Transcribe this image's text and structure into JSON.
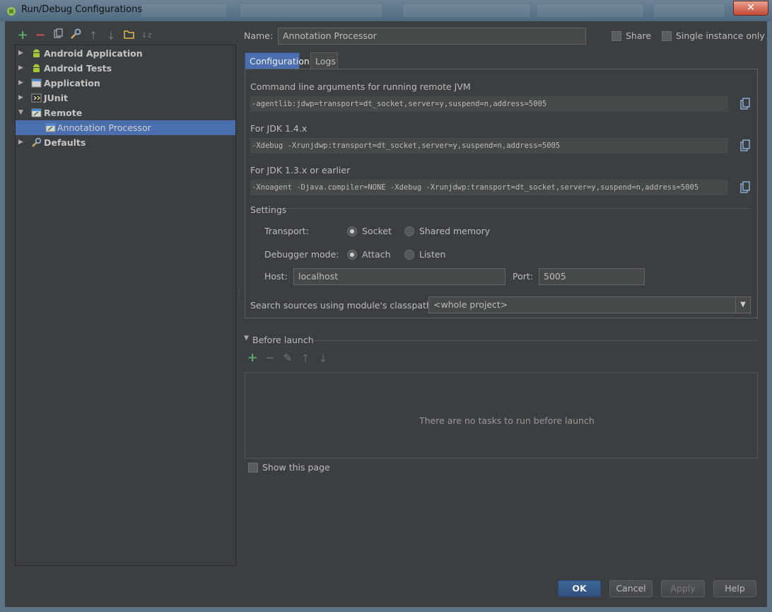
{
  "window": {
    "title": "Run/Debug Configurations",
    "close_glyph": "✕"
  },
  "toolbar_left": {
    "icons": [
      "plus-icon",
      "minus-icon",
      "copy-icon",
      "wrench-icon",
      "arrow-up-icon",
      "arrow-down-icon",
      "folder-icon",
      "sort-icon"
    ]
  },
  "tree": {
    "items": [
      {
        "label": "Android Application",
        "icon": "android-icon",
        "expanded": false
      },
      {
        "label": "Android Tests",
        "icon": "android-icon",
        "expanded": false
      },
      {
        "label": "Application",
        "icon": "application-icon",
        "expanded": false
      },
      {
        "label": "JUnit",
        "icon": "junit-icon",
        "expanded": false
      },
      {
        "label": "Remote",
        "icon": "remote-icon",
        "expanded": true
      },
      {
        "label": "Annotation Processor",
        "icon": "remote-icon",
        "child": true,
        "selected": true
      },
      {
        "label": "Defaults",
        "icon": "defaults-icon",
        "expanded": false
      }
    ]
  },
  "header": {
    "name_label": "Name:",
    "name_value": "Annotation Processor",
    "share_label": "Share",
    "single_instance_label": "Single instance only"
  },
  "tabs": [
    {
      "label": "Configuration",
      "active": true
    },
    {
      "label": "Logs",
      "active": false
    }
  ],
  "configuration": {
    "cmd_label": "Command line arguments for running remote JVM",
    "cmd_value": "-agentlib:jdwp=transport=dt_socket,server=y,suspend=n,address=5005",
    "jdk14_label": "For JDK 1.4.x",
    "jdk14_value": "-Xdebug -Xrunjdwp:transport=dt_socket,server=y,suspend=n,address=5005",
    "jdk13_label": "For JDK 1.3.x or earlier",
    "jdk13_value": "-Xnoagent -Djava.compiler=NONE -Xdebug -Xrunjdwp:transport=dt_socket,server=y,suspend=n,address=5005",
    "settings_label": "Settings",
    "transport_label": "Transport:",
    "transport_options": [
      "Socket",
      "Shared memory"
    ],
    "transport_selected": "Socket",
    "debugger_mode_label": "Debugger mode:",
    "debugger_mode_options": [
      "Attach",
      "Listen"
    ],
    "debugger_mode_selected": "Attach",
    "host_label": "Host:",
    "host_value": "localhost",
    "port_label": "Port:",
    "port_value": "5005",
    "classpath_label": "Search sources using module's classpath:",
    "classpath_value": "<whole project>"
  },
  "before_launch": {
    "label": "Before launch",
    "toolbar_icons": [
      "plus-icon",
      "minus-icon",
      "edit-icon",
      "arrow-up-icon",
      "arrow-down-icon"
    ],
    "empty_text": "There are no tasks to run before launch",
    "show_page_label": "Show this page"
  },
  "buttons": {
    "ok": "OK",
    "cancel": "Cancel",
    "apply": "Apply",
    "help": "Help"
  },
  "colors": {
    "background": "#3c3f41",
    "selection": "#4b6eaf",
    "add_green": "#59a869",
    "remove_red": "#c75450"
  }
}
